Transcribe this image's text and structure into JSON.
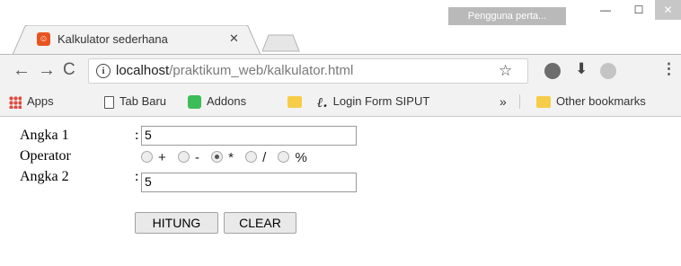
{
  "window": {
    "profile_label": "Pengguna perta...",
    "minimize_glyph": "—",
    "maximize_glyph": "☐",
    "close_glyph": "✕"
  },
  "tab": {
    "title": "Kalkulator sederhana",
    "favicon_glyph": "☺",
    "close_glyph": "✕"
  },
  "toolbar": {
    "back_glyph": "←",
    "forward_glyph": "→",
    "reload_glyph": "C",
    "url_host": "localhost",
    "url_path": "/praktikum_web/kalkulator.html",
    "info_glyph": "i",
    "star_glyph": "☆",
    "download_glyph": "⬇",
    "menu_glyph": "⋮"
  },
  "bookmarks": {
    "items": [
      {
        "label": "Apps",
        "icon": "apps-grid-icon"
      },
      {
        "label": "Tab Baru",
        "icon": "page-icon"
      },
      {
        "label": "Addons",
        "icon": "puzzle-icon"
      },
      {
        "label": "",
        "icon": "folder-icon"
      },
      {
        "label": "Login Form SIPUT",
        "icon": "script-l-icon",
        "glyph": "ℓ."
      }
    ],
    "overflow_glyph": "»",
    "other_label": "Other bookmarks"
  },
  "form": {
    "angka1_label": "Angka 1",
    "angka1_value": "5",
    "operator_label": "Operator",
    "operators": [
      "+",
      "-",
      "*",
      "/",
      "%"
    ],
    "selected_operator": "*",
    "angka2_label": "Angka 2",
    "angka2_value": "5",
    "colon": ":",
    "hitung_label": "HITUNG",
    "clear_label": "CLEAR"
  }
}
